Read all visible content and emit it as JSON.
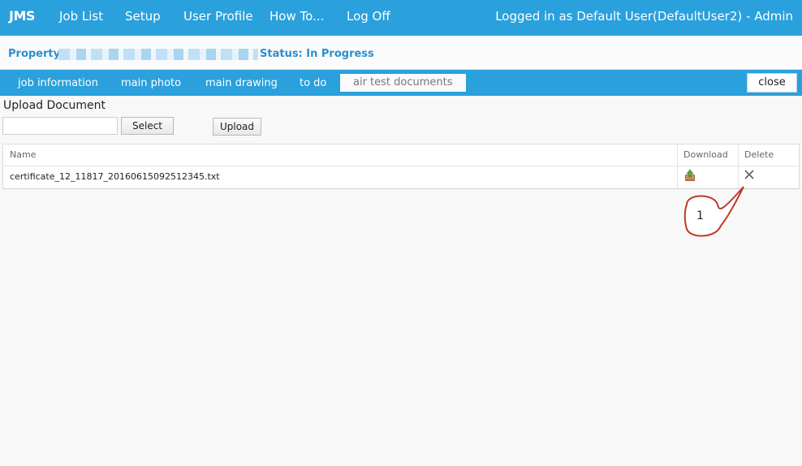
{
  "topnav": {
    "brand": "JMS",
    "items": [
      "Job List",
      "Setup",
      "User Profile",
      "How To...",
      "Log Off"
    ],
    "user_status": "Logged in as Default User(DefaultUser2) - Admin"
  },
  "property": {
    "label": "Property:",
    "status_label": "Status: In Progress"
  },
  "tabs": {
    "items": [
      "job information",
      "main photo",
      "main drawing",
      "to do",
      "air test documents"
    ],
    "active": "air test documents",
    "close_label": "close"
  },
  "upload": {
    "title": "Upload Document",
    "select_label": "Select",
    "upload_label": "Upload"
  },
  "documents_table": {
    "columns": [
      "Name",
      "Download",
      "Delete"
    ],
    "rows": [
      {
        "name": "certificate_12_11817_20160615092512345.txt"
      }
    ]
  },
  "callout": {
    "number": "1"
  },
  "icons": {
    "download": "download-icon",
    "delete": "delete-x-icon"
  },
  "colors": {
    "brand_blue": "#2aa0dc",
    "status_blue": "#2a8fcf",
    "callout_red": "#c0392b"
  }
}
